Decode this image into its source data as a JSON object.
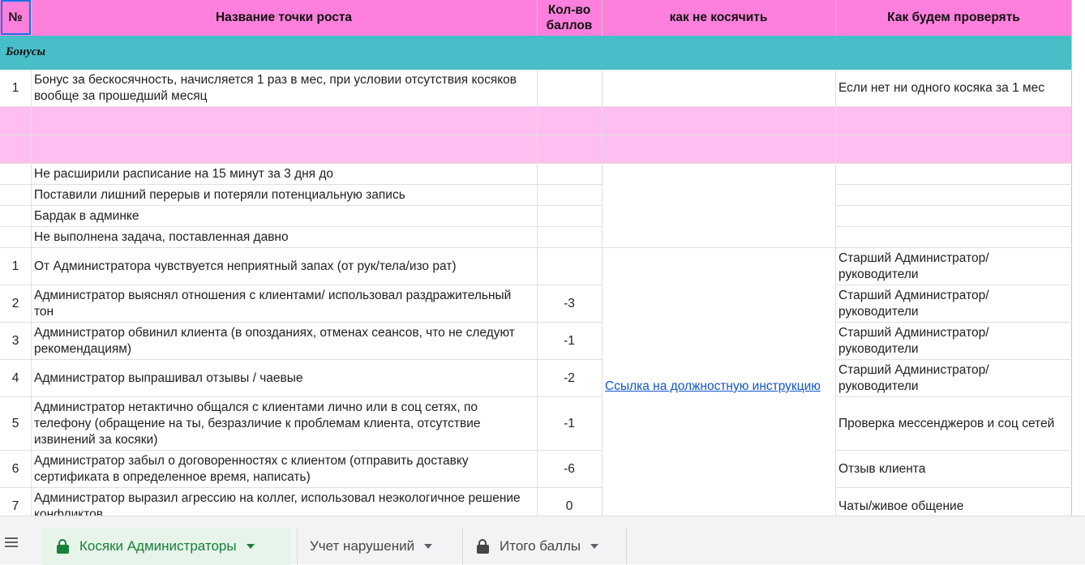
{
  "header": {
    "num": "№",
    "name": "Название точки роста",
    "points": "Кол-во баллов",
    "how_not": "как не косячить",
    "check": "Как будем проверять"
  },
  "section_title": "Бонусы",
  "bonus_row": {
    "num": "1",
    "name": "Бонус за бескосячность, начисляется 1 раз в мес, при условии отсутствия косяков вообще за прошедший месяц",
    "check": "Если нет ни одного косяка за 1 мес"
  },
  "plain_rows": [
    "Не расширили расписание на 15 минут за 3 дня до",
    "Поставили лишний перерыв и потеряли потенциальную запись",
    "Бардак в админке",
    "Не выполнена задача, поставленная давно"
  ],
  "rows": [
    {
      "num": "1",
      "name": "От Администратора чувствуется неприятный запах (от рук/тела/изо рат)",
      "points": "",
      "check": "Старший Администратор/руководители"
    },
    {
      "num": "2",
      "name": "Администратор выяснял отношения с клиентами/ использовал раздражительный тон",
      "points": "-3",
      "check": "Старший Администратор/руководители"
    },
    {
      "num": "3",
      "name": "Администратор обвинил клиента (в опозданиях, отменах сеансов, что не следуют рекомендациям)",
      "points": "-1",
      "check": "Старший Администратор/руководители"
    },
    {
      "num": "4",
      "name": "Администратор  выпрашивал отзывы / чаевые",
      "points": "-2",
      "check": "Старший Администратор/руководители"
    },
    {
      "num": "5",
      "name": "Администратор нетактично общался с клиентами лично или в соц сетях, по телефону (обращение на ты, безразличие к проблемам клиента, отсутствие извинений за косяки)",
      "points": "-1",
      "check": "Проверка мессенджеров и соц сетей"
    },
    {
      "num": "6",
      "name": "Администратор забыл о договоренностях с клиентом  (отправить доставку сертификата в определенное время, написать)",
      "points": "-6",
      "check": "Отзыв клиента"
    },
    {
      "num": "7",
      "name": "Администратор выразил агрессию на коллег, использовал неэкологичное решение конфликтов",
      "points": "0",
      "check": "Чаты/живое общение"
    }
  ],
  "link_text": "Ссылка на должностную инструкцию",
  "tabs": [
    {
      "label": "Косяки Администраторы",
      "locked": true,
      "active": true
    },
    {
      "label": "Учет нарушений",
      "locked": false,
      "active": false
    },
    {
      "label": "Итого баллы",
      "locked": true,
      "active": false
    }
  ],
  "colors": {
    "header": "#ff80dc",
    "section": "#48bec8",
    "pink_rows": "#ffbef0",
    "active_tab": "#188038",
    "link": "#1155cc"
  }
}
